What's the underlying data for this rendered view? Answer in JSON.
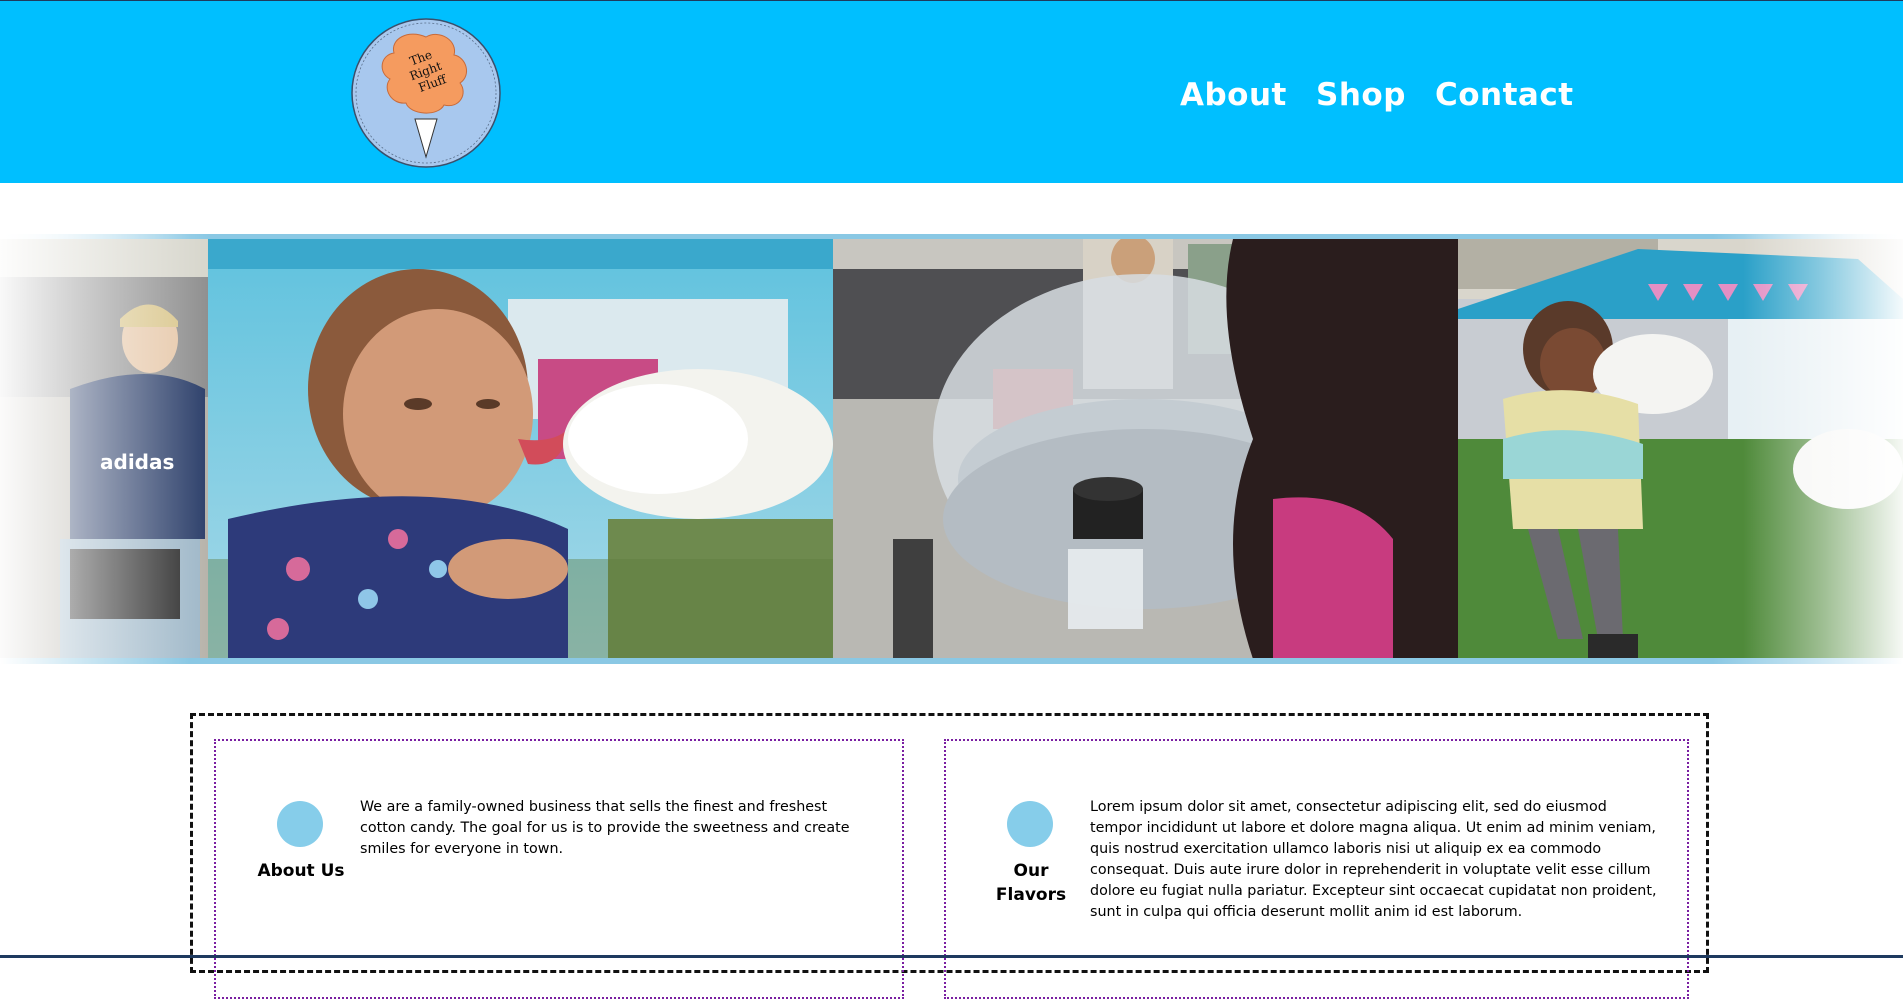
{
  "logo": {
    "text_line1": "The",
    "text_line2": "Right",
    "text_line3": "Fluff"
  },
  "nav": {
    "items": [
      {
        "label": "About"
      },
      {
        "label": "Shop"
      },
      {
        "label": "Contact"
      }
    ]
  },
  "colors": {
    "header": "#00bfff",
    "accent_dot": "#86cdea",
    "card_border": "#7a1fa2"
  },
  "sections": [
    {
      "title": "About Us",
      "body": "We are a family-owned business that sells the finest and freshest cotton candy. The goal for us is to provide the sweetness and create smiles for everyone in town."
    },
    {
      "title": "Our Flavors",
      "body": "Lorem ipsum dolor sit amet, consectetur adipiscing elit, sed do eiusmod tempor incididunt ut labore et dolore magna aliqua. Ut enim ad minim veniam, quis nostrud exercitation ullamco laboris nisi ut aliquip ex ea commodo consequat. Duis aute irure dolor in reprehenderit in voluptate velit esse cillum dolore eu fugiat nulla pariatur. Excepteur sint occaecat cupidatat non proident, sunt in culpa qui officia deserunt mollit anim id est laborum."
    }
  ]
}
